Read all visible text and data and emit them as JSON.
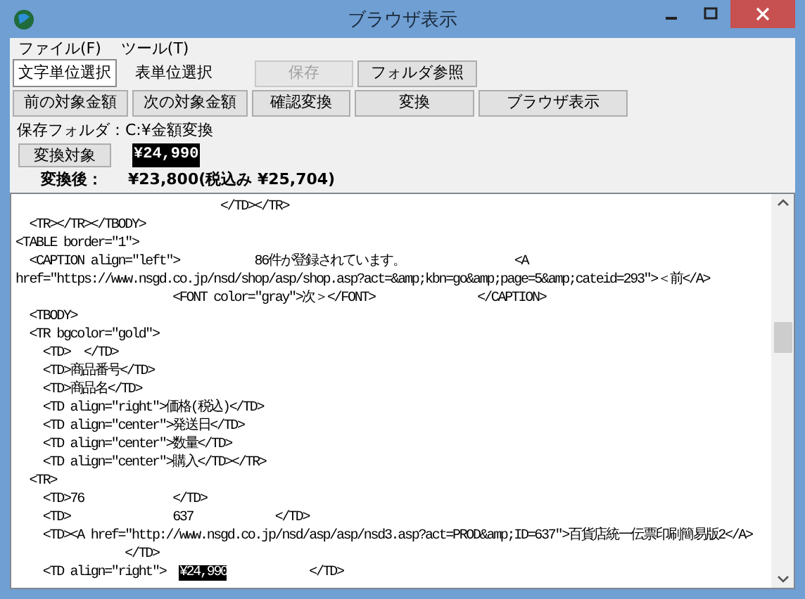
{
  "window": {
    "title": "ブラウザ表示"
  },
  "menu": [
    {
      "label": "ファイル(F)"
    },
    {
      "label": "ツール(T)"
    }
  ],
  "modes": [
    {
      "label": "文字単位選択",
      "selected": true
    },
    {
      "label": "表単位選択",
      "selected": false
    }
  ],
  "buttons_row1": [
    {
      "label": "保存",
      "disabled": true
    },
    {
      "label": "フォルダ参照",
      "disabled": false
    }
  ],
  "buttons_row2": [
    {
      "label": "前の対象金額",
      "disabled": false
    },
    {
      "label": "次の対象金額",
      "disabled": false
    },
    {
      "label": "確認変換",
      "disabled": false
    },
    {
      "label": "変換",
      "disabled": false
    },
    {
      "label": "ブラウザ表示",
      "disabled": false
    }
  ],
  "folder": "保存フォルダ：C:¥金額変換",
  "target": {
    "button": "変換対象",
    "value": "¥24,990",
    "selected": true
  },
  "result": {
    "label": "変換後：",
    "value": "¥23,800(税込み ¥25,704)"
  },
  "source_lines": [
    {
      "kind": "plain",
      "text": "                              </TD></TR>"
    },
    {
      "kind": "plain",
      "text": "  <TR></TR></TBODY>"
    },
    {
      "kind": "plain",
      "text": "<TABLE border=\"1\">"
    },
    {
      "kind": "plain",
      "text": "  <CAPTION align=\"left\">           86件が登録されています。                <A"
    },
    {
      "kind": "plain",
      "text": "href=\"https://www.nsgd.co.jp/nsd/shop/asp/shop.asp?act=&amp;kbn=go&amp;page=5&amp;cateid=293\">＜前</A>"
    },
    {
      "kind": "plain",
      "text": "                       <FONT color=\"gray\">次＞</FONT>               </CAPTION>"
    },
    {
      "kind": "plain",
      "text": "  <TBODY>"
    },
    {
      "kind": "plain",
      "text": "  <TR bgcolor=\"gold\">"
    },
    {
      "kind": "plain",
      "text": "    <TD>  </TD>"
    },
    {
      "kind": "plain",
      "text": "    <TD>商品番号</TD>"
    },
    {
      "kind": "plain",
      "text": "    <TD>商品名</TD>"
    },
    {
      "kind": "plain",
      "text": "    <TD align=\"right\">価格(税込)</TD>"
    },
    {
      "kind": "plain",
      "text": "    <TD align=\"center\">発送日</TD>"
    },
    {
      "kind": "plain",
      "text": "    <TD align=\"center\">数量</TD>"
    },
    {
      "kind": "plain",
      "text": "    <TD align=\"center\">購入</TD></TR>"
    },
    {
      "kind": "plain",
      "text": "  <TR>"
    },
    {
      "kind": "plain",
      "text": "    <TD>76             </TD>"
    },
    {
      "kind": "plain",
      "text": "    <TD>               637            </TD>"
    },
    {
      "kind": "plain",
      "text": "    <TD><A href=\"http://www.nsgd.co.jp/nsd/asp/asp/nsd3.asp?act=PROD&amp;ID=637\">百貨店統一伝票印刷簡易版2</A>"
    },
    {
      "kind": "plain",
      "text": "                </TD>"
    },
    {
      "kind": "mixed",
      "parts": [
        {
          "text": "    <TD align=\"right\">  ",
          "selected": false
        },
        {
          "text": "¥24,990",
          "selected": true
        },
        {
          "text": "            </TD>",
          "selected": false
        }
      ]
    }
  ]
}
